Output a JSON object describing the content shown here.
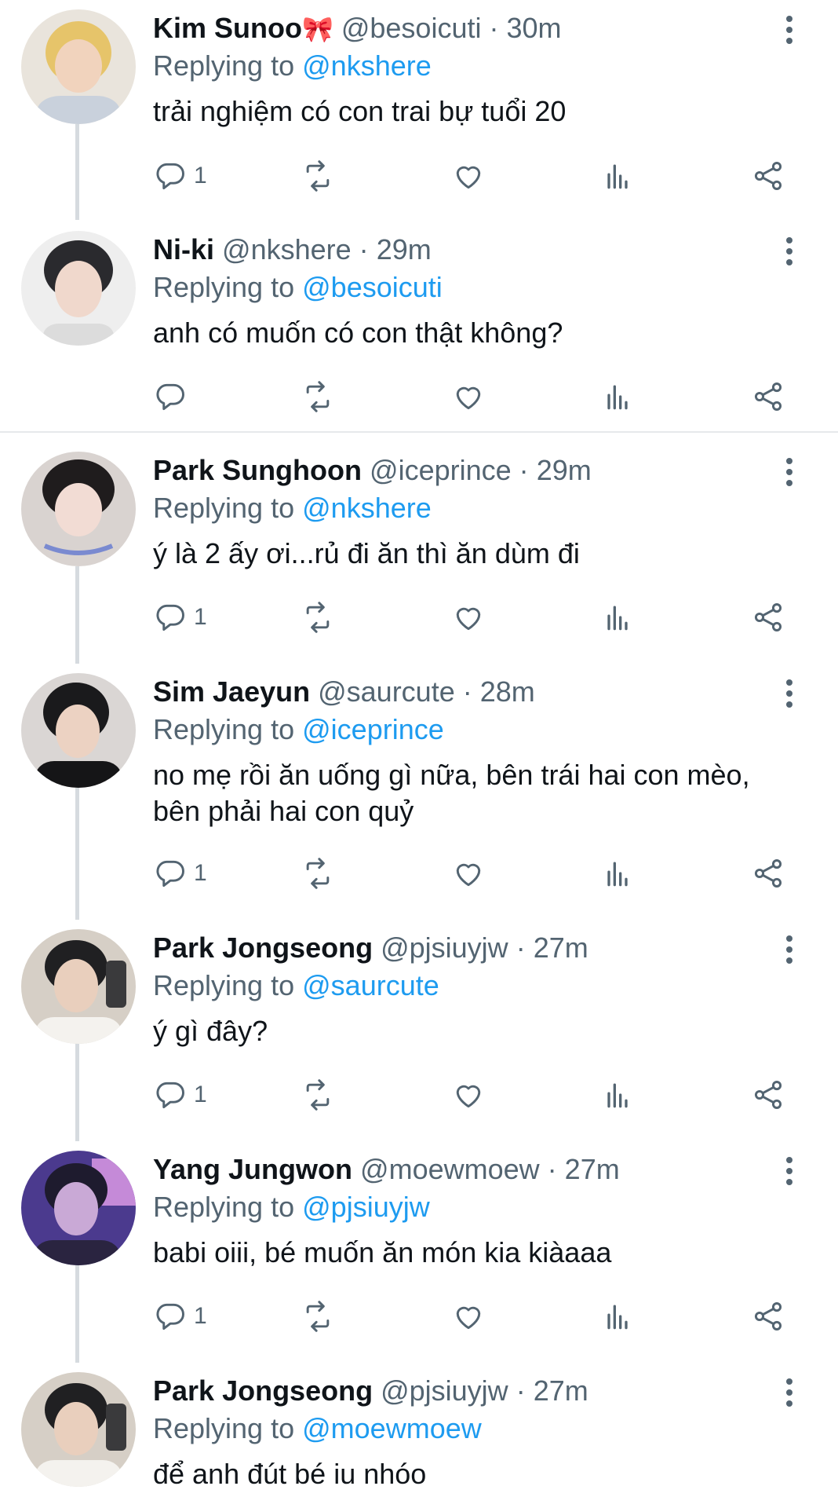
{
  "reply_label": "Replying to",
  "tweets": [
    {
      "name": "Kim Sunoo",
      "emoji": "🎀",
      "handle": "@besoicuti",
      "time": "30m",
      "reply_to": "@nkshere",
      "text": "trải nghiệm có con trai bự tuổi 20",
      "reply_count": "1"
    },
    {
      "name": "Ni-ki",
      "emoji": "",
      "handle": "@nkshere",
      "time": "29m",
      "reply_to": "@besoicuti",
      "text": "anh có muốn có con thật không?",
      "reply_count": ""
    },
    {
      "name": "Park Sunghoon",
      "emoji": "",
      "handle": "@iceprince",
      "time": "29m",
      "reply_to": "@nkshere",
      "text": "ý là 2 ấy ơi...rủ đi ăn thì ăn dùm đi",
      "reply_count": "1"
    },
    {
      "name": "Sim Jaeyun",
      "emoji": "",
      "handle": "@saurcute",
      "time": "28m",
      "reply_to": "@iceprince",
      "text": "no mẹ rồi ăn uống gì nữa, bên trái hai con mèo, bên phải hai con quỷ",
      "reply_count": "1"
    },
    {
      "name": "Park Jongseong",
      "emoji": "",
      "handle": "@pjsiuyjw",
      "time": "27m",
      "reply_to": "@saurcute",
      "text": "ý gì đây?",
      "reply_count": "1"
    },
    {
      "name": "Yang Jungwon",
      "emoji": "",
      "handle": "@moewmoew",
      "time": "27m",
      "reply_to": "@pjsiuyjw",
      "text": "babi oiii, bé muốn ăn món kia kiàaaa",
      "reply_count": "1"
    },
    {
      "name": "Park Jongseong",
      "emoji": "",
      "handle": "@pjsiuyjw",
      "time": "27m",
      "reply_to": "@moewmoew",
      "text": "để anh đút bé iu nhóo",
      "reply_count": ""
    }
  ],
  "colors": {
    "accent": "#1d9bf0",
    "muted": "#536471",
    "text": "#0f1419"
  }
}
